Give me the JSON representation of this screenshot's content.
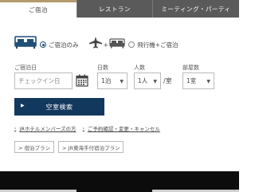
{
  "tabs": [
    {
      "label": "ご宿泊",
      "active": true
    },
    {
      "label": "レストラン",
      "active": false
    },
    {
      "label": "ミーティング・パーティ",
      "active": false
    }
  ],
  "mode": {
    "stay_only_label": "ご宿泊のみ",
    "flight_stay_label": "飛行機+ご宿泊",
    "selected": "stay_only"
  },
  "form": {
    "checkin_label": "ご宿泊日",
    "checkin_placeholder": "チェックイン日",
    "nights_label": "日数",
    "nights_value": "1泊",
    "guests_label": "人数",
    "guests_value": "1人",
    "per_room_text": "/室",
    "rooms_label": "部屋数",
    "rooms_value": "1室"
  },
  "search_button": "空室検索",
  "links": [
    "JRホテルメンバーズの方",
    "ご予約確認・変更・キャンセル"
  ],
  "plan_buttons": [
    "> 宿泊プラン",
    "> JR東海手付宿泊プラン"
  ],
  "colors": {
    "accent_gold": "#b59a6b",
    "navy": "#13385e",
    "tab_dark": "#5a5a5a",
    "footer": "#0c0c0c"
  }
}
